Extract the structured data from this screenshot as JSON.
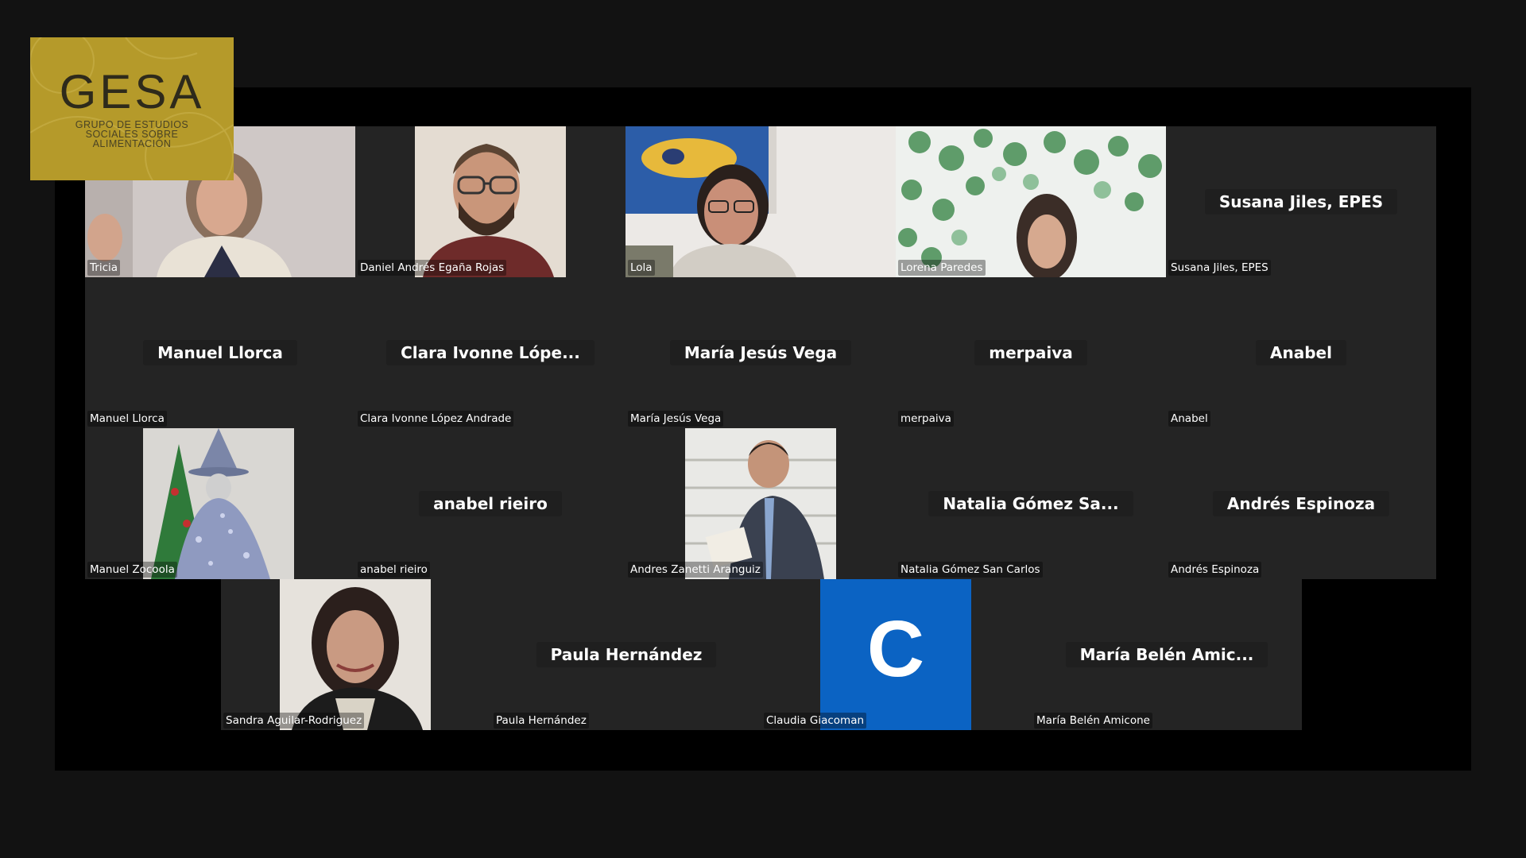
{
  "logo": {
    "title": "GESA",
    "subtitle_lines": [
      "GRUPO DE ESTUDIOS",
      "SOCIALES SOBRE",
      "ALIMENTACIÓN"
    ]
  },
  "colors": {
    "tile_background": "#242424",
    "meeting_background": "#000000",
    "page_background": "#121212",
    "logo_background": "#b59a2a",
    "avatar_blue": "#0b63c3"
  },
  "participants": [
    {
      "name": "Tricia",
      "display": "",
      "video": "woman-gray-hair"
    },
    {
      "name": "Daniel Andrés Egaña Rojas",
      "display": "",
      "video": "man-beard-glasses"
    },
    {
      "name": "Lola",
      "display": "",
      "video": "woman-glasses-painting"
    },
    {
      "name": "Lorena Paredes",
      "display": "",
      "video": "woman-leaves-background"
    },
    {
      "name": "Susana Jiles, EPES",
      "display": "Susana Jiles, EPES",
      "video": ""
    },
    {
      "name": "Manuel Llorca",
      "display": "Manuel Llorca",
      "video": ""
    },
    {
      "name": "Clara Ivonne López Andrade",
      "display": "Clara Ivonne Lópe...",
      "video": ""
    },
    {
      "name": "María Jesús Vega",
      "display": "María Jesús Vega",
      "video": ""
    },
    {
      "name": "merpaiva",
      "display": "merpaiva",
      "video": ""
    },
    {
      "name": "Anabel",
      "display": "Anabel",
      "video": ""
    },
    {
      "name": "Manuel Zocoola",
      "display": "",
      "video": "wizard-costume"
    },
    {
      "name": "anabel rieiro",
      "display": "anabel rieiro",
      "video": ""
    },
    {
      "name": "Andres Zanetti Aranguiz",
      "display": "",
      "video": "man-suit-reading"
    },
    {
      "name": "Natalia Gómez San Carlos",
      "display": "Natalia Gómez Sa...",
      "video": ""
    },
    {
      "name": "Andrés Espinoza",
      "display": "Andrés Espinoza",
      "video": ""
    },
    {
      "name": "Sandra Aguilar-Rodriguez",
      "display": "",
      "video": "woman-dark-hair"
    },
    {
      "name": "Paula Hernández",
      "display": "Paula Hernández",
      "video": ""
    },
    {
      "name": "Claudia Giacoman",
      "display": "",
      "video": "avatar-letter",
      "avatar_letter": "C"
    },
    {
      "name": "María Belén Amicone",
      "display": "María Belén Amic...",
      "video": ""
    }
  ]
}
